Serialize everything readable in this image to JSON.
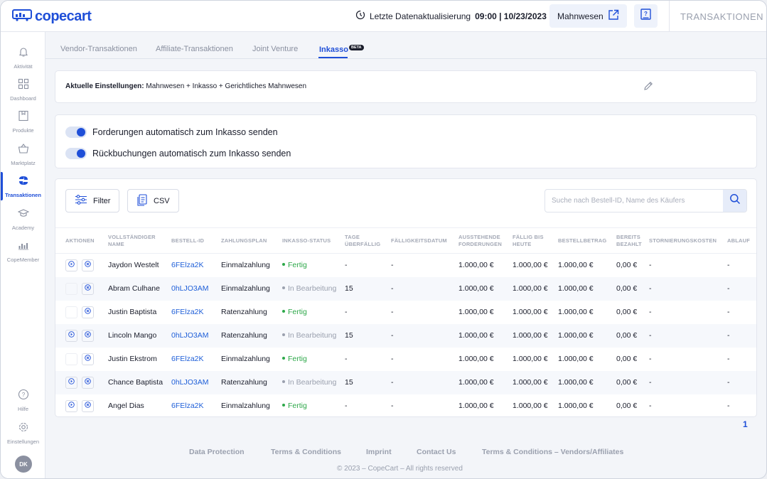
{
  "brand": {
    "name": "copecart",
    "color": "#1f4fd8"
  },
  "header": {
    "sync_label": "Letzte Datenaktualisierung",
    "sync_time": "09:00 | 10/23/2023",
    "mahnwesen_label": "Mahnwesen",
    "page_title": "TRANSAKTIONEN"
  },
  "sidebar": {
    "items": [
      {
        "label": "Aktivität",
        "icon": "bell-icon"
      },
      {
        "label": "Dashboard",
        "icon": "grid-icon"
      },
      {
        "label": "Produkte",
        "icon": "product-icon"
      },
      {
        "label": "Marktplatz",
        "icon": "basket-icon"
      },
      {
        "label": "Transaktionen",
        "icon": "transactions-icon",
        "active": true
      },
      {
        "label": "Academy",
        "icon": "graduation-cap-icon"
      },
      {
        "label": "CopeMember",
        "icon": "members-icon"
      }
    ],
    "bottom": [
      {
        "label": "Hilfe",
        "icon": "help-icon"
      },
      {
        "label": "Einstellungen",
        "icon": "gear-icon"
      }
    ],
    "avatar": "DK"
  },
  "tabs": [
    {
      "label": "Vendor-Transaktionen"
    },
    {
      "label": "Affiliate-Transaktionen"
    },
    {
      "label": "Joint Venture"
    },
    {
      "label": "Inkasso",
      "badge": "BETA",
      "active": true
    }
  ],
  "settings": {
    "label": "Aktuelle Einstellungen:",
    "value": "Mahnwesen + Inkasso + Gerichtliches Mahnwesen"
  },
  "toggles": [
    {
      "label": "Forderungen automatisch zum Inkasso senden",
      "on": true
    },
    {
      "label": "Rückbuchungen automatisch zum Inkasso senden",
      "on": true
    }
  ],
  "toolbar": {
    "filter_label": "Filter",
    "csv_label": "CSV",
    "search_placeholder": "Suche nach Bestell-ID, Name des Käufers"
  },
  "table": {
    "columns": [
      "Aktionen",
      "Vollständiger Name",
      "Bestell-ID",
      "Zahlungsplan",
      "Inkasso-Status",
      "Tage überfällig",
      "Fälligkeitsdatum",
      "Ausstehende Forderungen",
      "Fällig bis heute",
      "Bestellbetrag",
      "Bereits bezahlt",
      "Stornierungskosten",
      "Ablauf"
    ],
    "rows": [
      {
        "name": "Jaydon Westelt",
        "order_id": "6FElza2K",
        "plan": "Einmalzahlung",
        "status": "Fertig",
        "status_type": "done",
        "overdue": "-",
        "due_date": "-",
        "outstanding": "1.000,00 €",
        "due_today": "1.000,00 €",
        "amount": "1.000,00 €",
        "paid": "0,00 €",
        "cancel": "-",
        "expiry": "-",
        "play_enabled": true
      },
      {
        "name": "Abram Culhane",
        "order_id": "0hLJO3AM",
        "plan": "Einmalzahlung",
        "status": "In Bearbeitung",
        "status_type": "progress",
        "overdue": "15",
        "due_date": "-",
        "outstanding": "1.000,00 €",
        "due_today": "1.000,00 €",
        "amount": "1.000,00 €",
        "paid": "0,00 €",
        "cancel": "-",
        "expiry": "-",
        "play_enabled": false
      },
      {
        "name": "Justin Baptista",
        "order_id": "6FElza2K",
        "plan": "Ratenzahlung",
        "status": "Fertig",
        "status_type": "done",
        "overdue": "-",
        "due_date": "-",
        "outstanding": "1.000,00 €",
        "due_today": "1.000,00 €",
        "amount": "1.000,00 €",
        "paid": "0,00 €",
        "cancel": "-",
        "expiry": "-",
        "play_enabled": false
      },
      {
        "name": "Lincoln Mango",
        "order_id": "0hLJO3AM",
        "plan": "Ratenzahlung",
        "status": "In Bearbeitung",
        "status_type": "progress",
        "overdue": "15",
        "due_date": "-",
        "outstanding": "1.000,00 €",
        "due_today": "1.000,00 €",
        "amount": "1.000,00 €",
        "paid": "0,00 €",
        "cancel": "-",
        "expiry": "-",
        "play_enabled": true
      },
      {
        "name": "Justin Ekstrom",
        "order_id": "6FElza2K",
        "plan": "Einmalzahlung",
        "status": "Fertig",
        "status_type": "done",
        "overdue": "-",
        "due_date": "-",
        "outstanding": "1.000,00 €",
        "due_today": "1.000,00 €",
        "amount": "1.000,00 €",
        "paid": "0,00 €",
        "cancel": "-",
        "expiry": "-",
        "play_enabled": false
      },
      {
        "name": "Chance Baptista",
        "order_id": "0hLJO3AM",
        "plan": "Ratenzahlung",
        "status": "In Bearbeitung",
        "status_type": "progress",
        "overdue": "15",
        "due_date": "-",
        "outstanding": "1.000,00 €",
        "due_today": "1.000,00 €",
        "amount": "1.000,00 €",
        "paid": "0,00 €",
        "cancel": "-",
        "expiry": "-",
        "play_enabled": true
      },
      {
        "name": "Angel Dias",
        "order_id": "6FElza2K",
        "plan": "Einmalzahlung",
        "status": "Fertig",
        "status_type": "done",
        "overdue": "-",
        "due_date": "-",
        "outstanding": "1.000,00 €",
        "due_today": "1.000,00 €",
        "amount": "1.000,00 €",
        "paid": "0,00 €",
        "cancel": "-",
        "expiry": "-",
        "play_enabled": true
      }
    ]
  },
  "pagination": {
    "current": "1"
  },
  "footer": {
    "links": [
      "Data Protection",
      "Terms & Conditions",
      "Imprint",
      "Contact Us",
      "Terms & Conditions – Vendors/Affiliates"
    ],
    "copyright": "© 2023 – CopeCart – All rights reserved"
  }
}
